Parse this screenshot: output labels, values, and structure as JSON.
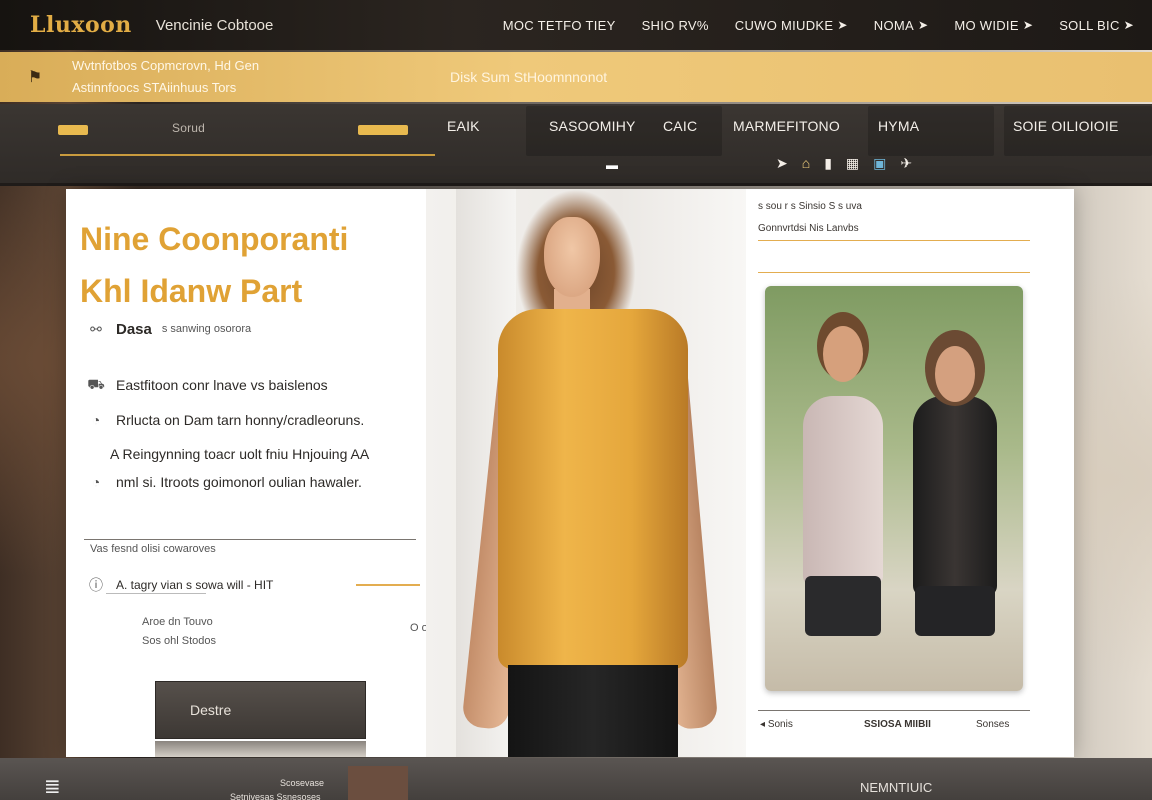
{
  "brand": {
    "logo": "Lluxoon",
    "tagline": "Vencinie Cobtooe"
  },
  "top_nav": [
    {
      "label": "MOC TETFO TIEY"
    },
    {
      "label": "SHIO RV%"
    },
    {
      "label": "CUWO MIUDKE"
    },
    {
      "label": "NOMA"
    },
    {
      "label": "MO WIDIE"
    },
    {
      "label": "SOLL BIC"
    }
  ],
  "gold_strip": {
    "line1": "Wvtnfotbos Copmcrovn, Hd Gen",
    "line2": "Astinnfoocs STAiinhuus Tors",
    "center": "Disk Sum StHoomnnonot"
  },
  "nav": {
    "links": [
      "EAIK",
      "SASOOMIHY",
      "CAIC",
      "MARMEFITONO",
      "HYMA",
      "SOIE OILIOIOIE"
    ],
    "search_label": "Sorud"
  },
  "hero": {
    "title_line1": "Nine Coonporanti",
    "title_line2": "Khl Idanw Part",
    "brand_chip": "Dasa",
    "brand_sub": "s sanwing osorora",
    "lines": [
      "Eastfitoon conr lnave vs baislenos",
      "Rrlucta on Dam tarn honny/cradleoruns.",
      "A Reingynning toacr uolt fniu Hnjouing AA",
      "nml si. Itroots goimonorl oulian hawaler."
    ],
    "section_label": "Vas fesnd olisi cowaroves",
    "slider_label": "A. tagry vian s sowa will - HIT",
    "small_line1": "Aroe dn Touvo",
    "small_line2": "Sos ohl Stodos",
    "toggle_text": "O o",
    "cta_label": "Destre"
  },
  "right_col": {
    "line1": "s sou r s Sinsio   S s uva",
    "line2": "Gonnvrtdsi Nis Lanvbs",
    "footer_left": "Sonis",
    "footer_center": "SSIOSA MIIBII",
    "footer_right": "Sonses"
  },
  "bottom": {
    "left": "Scosevase",
    "center": "Setnivesas Ssnesoses",
    "right": "NEMNTIUIC"
  },
  "colors": {
    "gold": "#e2ad45",
    "dark": "#2f2b28",
    "panel": "#ffffff"
  },
  "icons": [
    "flag-icon",
    "arrow-icon",
    "home-icon",
    "user-icon",
    "grid-icon",
    "photo-icon",
    "cart-icon",
    "check-icon"
  ]
}
